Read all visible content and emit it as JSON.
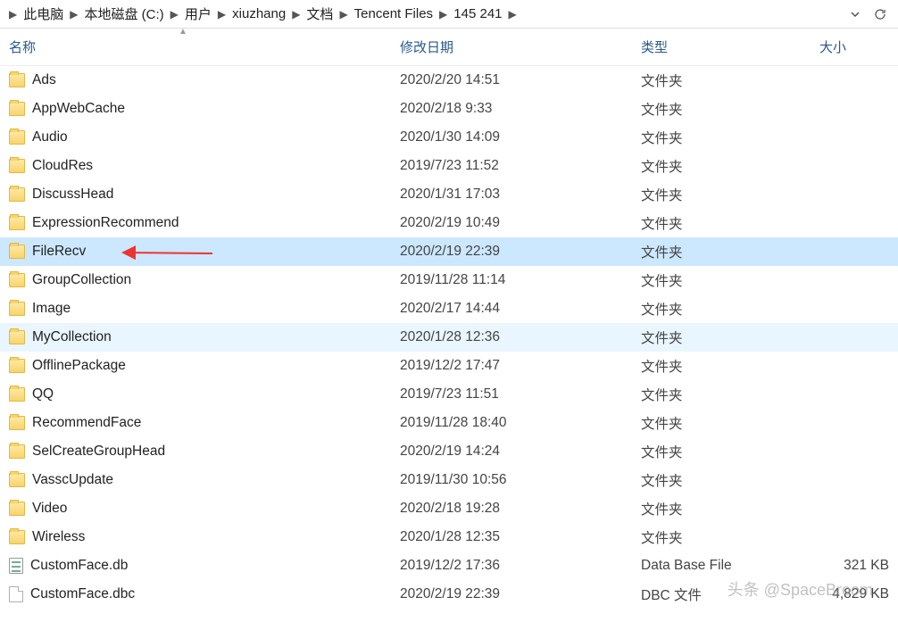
{
  "breadcrumb": {
    "items": [
      {
        "label": "此电脑"
      },
      {
        "label": "本地磁盘 (C:)"
      },
      {
        "label": "用户"
      },
      {
        "label": "xiuzhang"
      },
      {
        "label": "文档"
      },
      {
        "label": "Tencent Files"
      },
      {
        "label": "145        241"
      }
    ]
  },
  "columns": {
    "name": "名称",
    "date": "修改日期",
    "type": "类型",
    "size": "大小"
  },
  "rows": [
    {
      "icon": "folder",
      "name": "Ads",
      "date": "2020/2/20 14:51",
      "type": "文件夹",
      "size": ""
    },
    {
      "icon": "folder",
      "name": "AppWebCache",
      "date": "2020/2/18 9:33",
      "type": "文件夹",
      "size": ""
    },
    {
      "icon": "folder",
      "name": "Audio",
      "date": "2020/1/30 14:09",
      "type": "文件夹",
      "size": ""
    },
    {
      "icon": "folder",
      "name": "CloudRes",
      "date": "2019/7/23 11:52",
      "type": "文件夹",
      "size": ""
    },
    {
      "icon": "folder",
      "name": "DiscussHead",
      "date": "2020/1/31 17:03",
      "type": "文件夹",
      "size": ""
    },
    {
      "icon": "folder",
      "name": "ExpressionRecommend",
      "date": "2020/2/19 10:49",
      "type": "文件夹",
      "size": ""
    },
    {
      "icon": "folder",
      "name": "FileRecv",
      "date": "2020/2/19 22:39",
      "type": "文件夹",
      "size": "",
      "selected": true,
      "arrow": true
    },
    {
      "icon": "folder",
      "name": "GroupCollection",
      "date": "2019/11/28 11:14",
      "type": "文件夹",
      "size": ""
    },
    {
      "icon": "folder",
      "name": "Image",
      "date": "2020/2/17 14:44",
      "type": "文件夹",
      "size": ""
    },
    {
      "icon": "folder",
      "name": "MyCollection",
      "date": "2020/1/28 12:36",
      "type": "文件夹",
      "size": "",
      "hoverLight": true
    },
    {
      "icon": "folder",
      "name": "OfflinePackage",
      "date": "2019/12/2 17:47",
      "type": "文件夹",
      "size": ""
    },
    {
      "icon": "folder",
      "name": "QQ",
      "date": "2019/7/23 11:51",
      "type": "文件夹",
      "size": ""
    },
    {
      "icon": "folder",
      "name": "RecommendFace",
      "date": "2019/11/28 18:40",
      "type": "文件夹",
      "size": ""
    },
    {
      "icon": "folder",
      "name": "SelCreateGroupHead",
      "date": "2020/2/19 14:24",
      "type": "文件夹",
      "size": ""
    },
    {
      "icon": "folder",
      "name": "VasscUpdate",
      "date": "2019/11/30 10:56",
      "type": "文件夹",
      "size": ""
    },
    {
      "icon": "folder",
      "name": "Video",
      "date": "2020/2/18 19:28",
      "type": "文件夹",
      "size": ""
    },
    {
      "icon": "folder",
      "name": "Wireless",
      "date": "2020/1/28 12:35",
      "type": "文件夹",
      "size": ""
    },
    {
      "icon": "db",
      "name": "CustomFace.db",
      "date": "2019/12/2 17:36",
      "type": "Data Base File",
      "size": "321 KB"
    },
    {
      "icon": "file",
      "name": "CustomFace.dbc",
      "date": "2020/2/19 22:39",
      "type": "DBC 文件",
      "size": "4,829 KB"
    }
  ],
  "watermark": "头条 @SpaceBroom"
}
